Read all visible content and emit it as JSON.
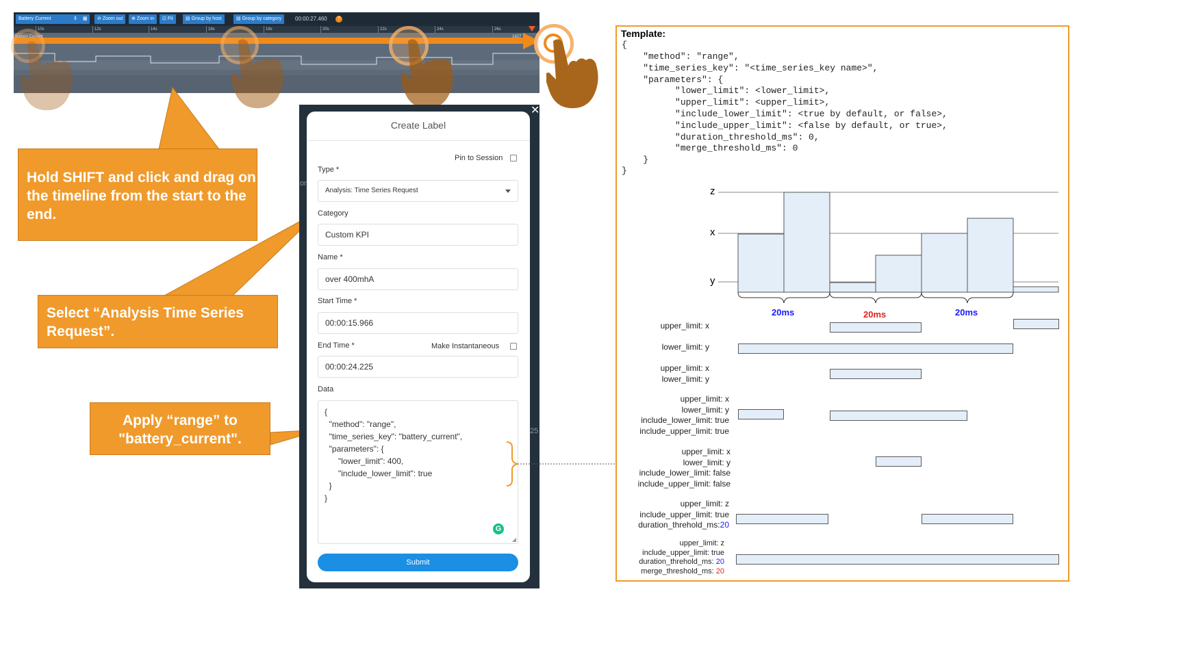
{
  "timeline": {
    "channel": "Battery Current",
    "zoom_out": "Zoom out",
    "zoom_in": "Zoom in",
    "fit": "Fit",
    "group_host": "Group by host",
    "group_category": "Group by category",
    "time": "00:00:27.460",
    "ticks": [
      "10s",
      "12s",
      "14s",
      "16s",
      "18s",
      "20s",
      "22s",
      "24s",
      "26s"
    ],
    "track_label": "Battery Current",
    "value_label": "1427"
  },
  "callouts": {
    "shift_drag": "Hold SHIFT and click and drag on the timeline from the start to the end.",
    "select_type": "Select “Analysis Time Series Request”.",
    "apply_range": "Apply “range” to \"battery_current\"."
  },
  "dialog": {
    "title": "Create Label",
    "pin_label": "Pin to Session",
    "type_label": "Type *",
    "type_value": "Analysis: Time Series Request",
    "category_label": "Category",
    "category_value": "Custom KPI",
    "name_label": "Name *",
    "name_value": "over 400mhA",
    "start_label": "Start Time *",
    "start_value": "00:00:15.966",
    "end_label": "End Time *",
    "instant_label": "Make Instantaneous",
    "end_value": "00:00:24.225",
    "data_label": "Data",
    "data_lines": [
      "{",
      "  \"method\": \"range\",",
      "  \"time_series_key\": \"battery_current\",",
      "  \"parameters\": {",
      "      \"lower_limit\": 400,",
      "      \"include_lower_limit\": true",
      "  }",
      "}"
    ],
    "submit": "Submit",
    "partial_left": "on",
    "partial_right": "25"
  },
  "template": {
    "title": "Template:",
    "lines": [
      "{",
      "    \"method\": \"range\",",
      "    \"time_series_key\": \"<time_series_key name>\",",
      "    \"parameters\": {",
      "          \"lower_limit\": <lower_limit>,",
      "          \"upper_limit\": <upper_limit>,",
      "          \"include_lower_limit\": <true by default, or false>,",
      "          \"include_upper_limit\": <false by default, or true>,",
      "          \"duration_threshold_ms\": 0,",
      "          \"merge_threshold_ms\": 0",
      "    }",
      "}"
    ]
  },
  "diagram": {
    "axis_z": "z",
    "axis_x": "x",
    "axis_y": "y",
    "ms_labels": [
      "20ms",
      "20ms",
      "20ms"
    ],
    "colors": {
      "blue": "#1a1aff",
      "red": "#e02020"
    },
    "cases": [
      {
        "lines": [
          "upper_limit: x"
        ]
      },
      {
        "lines": [
          "lower_limit: y"
        ]
      },
      {
        "lines": [
          "upper_limit: x",
          "lower_limit: y"
        ]
      },
      {
        "lines": [
          "upper_limit: x",
          "lower_limit: y",
          "include_lower_limit: true",
          "include_upper_limit: true"
        ]
      },
      {
        "lines": [
          "upper_limit: x",
          "lower_limit: y",
          "include_lower_limit: false",
          "include_upper_limit: false"
        ]
      },
      {
        "lines": [
          "upper_limit: z",
          "include_upper_limit: true"
        ],
        "dur_label": "duration_threhold_ms:",
        "dur_value": "20"
      },
      {
        "lines": [
          "upper_limit: z",
          "include_upper_limit: true"
        ],
        "dur_label": "duration_threhold_ms: ",
        "dur_value": "20",
        "merge_label": "merge_threshold_ms: ",
        "merge_value": "20"
      }
    ]
  }
}
